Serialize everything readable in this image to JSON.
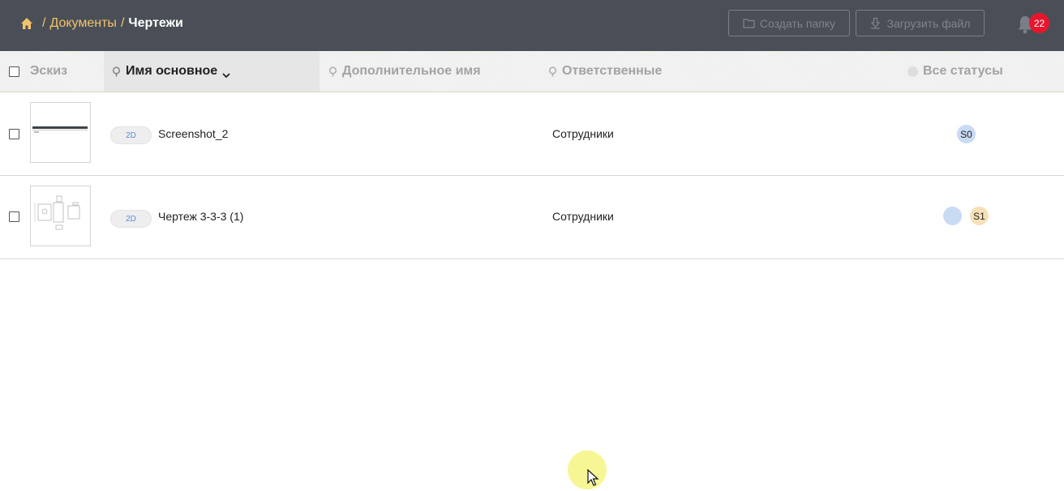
{
  "breadcrumb": {
    "items": [
      {
        "label": "Документы"
      }
    ],
    "separator": "/",
    "current": "Чертежи"
  },
  "toolbar": {
    "create_folder_label": "Создать папку",
    "upload_file_label": "Загрузить файл",
    "notification_count": "22"
  },
  "table": {
    "columns": {
      "sketch": "Эскиз",
      "main_name": "Имя основное",
      "extra_name": "Дополнительное имя",
      "responsible": "Ответственные",
      "statuses": "Все статусы"
    },
    "rows": [
      {
        "type": "2D",
        "name": "Screenshot_2",
        "responsible": "Сотрудники",
        "statuses": [
          {
            "label": "S0",
            "color": "#c9daf3"
          }
        ]
      },
      {
        "type": "2D",
        "name": "Чертеж 3-3-3 (1)",
        "responsible": "Сотрудники",
        "statuses": [
          {
            "label": "",
            "color": "#c9daf3"
          },
          {
            "label": "S1",
            "color": "#f7e0b8"
          }
        ]
      }
    ]
  },
  "colors": {
    "topbar": "#4a4f57",
    "breadcrumb_link": "#f2c36b",
    "badge": "#e8162d",
    "tag_text": "#5b8dd6"
  }
}
